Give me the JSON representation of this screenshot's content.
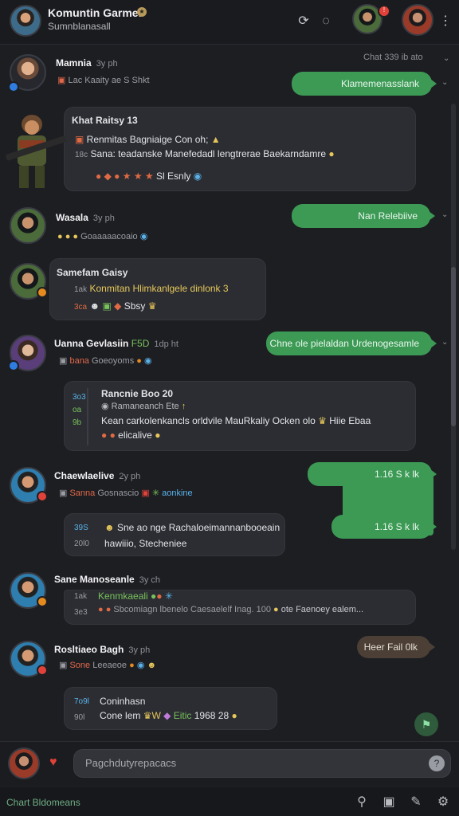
{
  "header": {
    "title": "Komuntin Garmer",
    "subtitle": "Sumnblanasall",
    "icons": [
      "refresh-icon",
      "chat-icon"
    ]
  },
  "top_hint": "Chat  339 ib ato",
  "messages": [
    {
      "name": "Mamnia",
      "meta": "3y ph",
      "sub": "Lac   Kaaity ae   S  Shkt",
      "reply": "Klamemenasslank"
    },
    {
      "card_title": "Khat Raitsy  13",
      "line1": "Renmitas Bagniaige Con oh;",
      "line2_prefix": "18c",
      "line2": "Sana: teadanske Manefedadl lengtrerae Baekarndamre",
      "line3": "Sl  Esnly"
    },
    {
      "name": "Wasala",
      "meta": "3y ph",
      "sub": "Goaaaaacoaio",
      "reply": "Nan Relebiive"
    },
    {
      "name": "Samefam Gaisy",
      "card_line1_prefix": "1ak",
      "card_line1": "Konmitan Hlimkanlgele dinlonk 3",
      "card_line2_prefix": "3ca",
      "card_line2": "Sbsy"
    },
    {
      "name": "Uanna Gevlasiin",
      "meta_green": "F5D",
      "meta": "1dp ht",
      "sub_prefix": "bana",
      "sub": "Goeoyoms",
      "reply": "Chne ole pielaldan Urdenogesamle"
    },
    {
      "card_title": "Rancnie  Boo 20",
      "prefix_blue": "3o3",
      "prefix_green1": "oa",
      "prefix_green2": "9b",
      "line1": "Ramaneanch  Ete",
      "line2": "Kean carkolenkancls orldvile MauRkaliy Ocken  olo",
      "line2_end": "Hiie Ebaa",
      "line3": "elicalive"
    },
    {
      "name": "Chaewlaelive",
      "meta": "2y ph",
      "sub_prefix": "Sanna",
      "sub": "Gosnascio",
      "sub_end": "aonkine",
      "reply1": "1.16 S k  lk",
      "reply2": "1.16 S k  lk",
      "card_prefix1": "39S",
      "card_prefix2": "20l0",
      "card_line1": "Sne  ao  nge Rachaloeimannanbooeain",
      "card_line2": "hawiiio, Stecheniee"
    },
    {
      "name": "Sane Manoseanle",
      "meta": "3y ch",
      "card_prefix1": "1ak",
      "card_line1": "Kenmkaeali",
      "card_prefix2": "3e3",
      "card_line2": "Sbcomiagn lbenelo  Caesaelelf Inag.  100",
      "card_line2_end": "ote  Faenoey  ealem..."
    },
    {
      "name": "Rosltiaeo Bagh",
      "meta": "3y ph",
      "sub_prefix": "Sone",
      "sub": "Leeaeoe",
      "reply": "Heer Fail 0lk",
      "card_prefix1": "7o9l",
      "card_prefix2": "90l",
      "card_line1": "Coninhasn",
      "card_line2": "Cone lem",
      "card_line2_mid": "Eitic",
      "card_line2_end": "1968  28"
    }
  ],
  "composer": {
    "placeholder": "Pagchdutyrepacacs"
  },
  "footer": {
    "label": "Chart Bldomeans"
  },
  "colors": {
    "background": "#1d1e22",
    "accent_green": "#3c9a55",
    "card": "#2b2d32",
    "badge_blue": "#2f7de1",
    "badge_orange": "#e58a1f"
  }
}
